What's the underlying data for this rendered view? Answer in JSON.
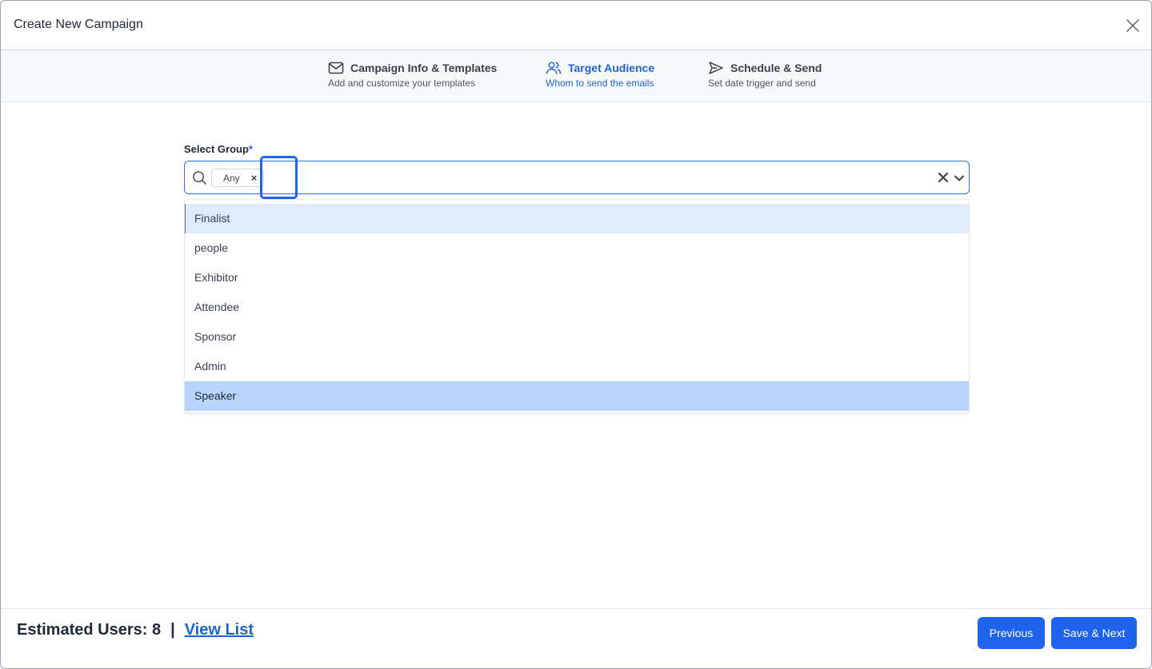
{
  "modal": {
    "title": "Create New Campaign"
  },
  "steps": [
    {
      "title": "Campaign Info & Templates",
      "subtitle": "Add and customize your templates",
      "icon": "mail-icon",
      "active": false
    },
    {
      "title": "Target Audience",
      "subtitle": "Whom to send the emails",
      "icon": "users-icon",
      "active": true
    },
    {
      "title": "Schedule & Send",
      "subtitle": "Set date trigger and send",
      "icon": "send-icon",
      "active": false
    }
  ],
  "form": {
    "label": "Select Group",
    "required_mark": "*",
    "selected_chip": "Any",
    "chip_remove": "×",
    "options": [
      "Finalist",
      "people",
      "Exhibitor",
      "Attendee",
      "Sponsor",
      "Admin",
      "Speaker"
    ]
  },
  "footer": {
    "estimated_label": "Estimated Users: 8",
    "separator": "|",
    "view_list": "View List",
    "previous": "Previous",
    "save_next": "Save & Next"
  },
  "colors": {
    "accent": "#1d63ed",
    "active_step": "#1d63d8",
    "option_hover": "#dfebfb",
    "option_selected": "#b8d4fb"
  }
}
